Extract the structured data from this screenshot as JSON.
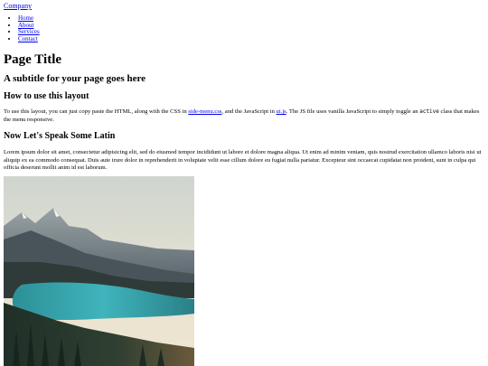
{
  "site": {
    "brand": "Company"
  },
  "nav": {
    "items": [
      {
        "label": "Home"
      },
      {
        "label": "About"
      },
      {
        "label": "Services"
      },
      {
        "label": "Contact"
      }
    ]
  },
  "main": {
    "title": "Page Title",
    "subtitle": "A subtitle for your page goes here",
    "sections": [
      {
        "heading": "How to use this layout",
        "text_before_link1": "To use this layout, you can just copy paste the HTML, along with the CSS in ",
        "link1": "side-menu.css",
        "text_between_links": ", and the JavaScript in ",
        "link2": "ui.js",
        "text_before_code": ". The JS file uses vanilla JavaScript to simply toggle an ",
        "code": "active",
        "text_after_code": " class that makes the menu responsive."
      },
      {
        "heading": "Now Let's Speak Some Latin",
        "paragraph": "Lorem ipsum dolor sit amet, consectetur adipisicing elit, sed do eiusmod tempor incididunt ut labore et dolore magna aliqua. Ut enim ad minim veniam, quis nostrud exercitation ullamco laboris nisi ut aliquip ex ea commodo consequat. Duis aute irure dolor in reprehenderit in voluptate velit esse cillum dolore eu fugiat nulla pariatur. Excepteur sint occaecat cupidatat non proident, sunt in culpa qui officia deserunt mollit anim id est laborum."
      }
    ]
  },
  "colors": {
    "link": "#0000ee",
    "text": "#000000",
    "background": "#ffffff"
  }
}
